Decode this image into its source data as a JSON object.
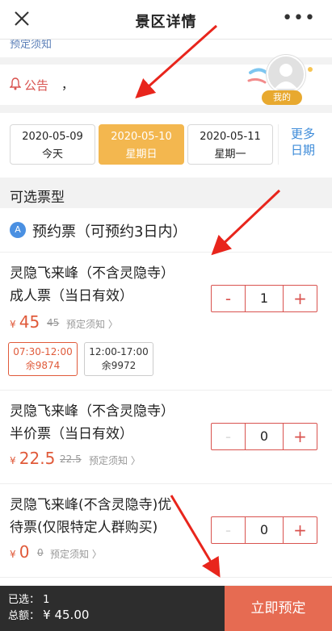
{
  "header": {
    "title": "景区详情",
    "more": "•••"
  },
  "top_strip": {
    "text": "预定须知"
  },
  "notice": {
    "label": "公告",
    "text": "，"
  },
  "avatar": {
    "badge": "我的"
  },
  "dates": [
    {
      "date": "2020-05-09",
      "weekday": "今天",
      "selected": false
    },
    {
      "date": "2020-05-10",
      "weekday": "星期日",
      "selected": true
    },
    {
      "date": "2020-05-11",
      "weekday": "星期一",
      "selected": false
    }
  ],
  "more_dates": {
    "line1": "更多",
    "line2": "日期"
  },
  "section_title": "可选票型",
  "group": {
    "icon": "A",
    "title": "预约票（可预约3日内）"
  },
  "tickets": [
    {
      "name_line1": "灵隐飞来峰（不含灵隐寺）",
      "name_line2": "成人票（当日有效）",
      "currency": "¥",
      "price": "45",
      "original": "45",
      "notice_link": "预定须知",
      "quantity": "1",
      "slots": [
        {
          "time": "07:30-12:00",
          "remain": "余9874",
          "selected": true
        },
        {
          "time": "12:00-17:00",
          "remain": "余9972",
          "selected": false
        }
      ]
    },
    {
      "name_line1": "灵隐飞来峰（不含灵隐寺）",
      "name_line2": "半价票（当日有效）",
      "currency": "¥",
      "price": "22.5",
      "original": "22.5",
      "notice_link": "预定须知",
      "quantity": "0"
    },
    {
      "name_line1": "灵隐飞来峰(不含灵隐寺)优",
      "name_line2": "待票(仅限特定人群购买)",
      "currency": "¥",
      "price": "0",
      "original": "0",
      "notice_link": "预定须知",
      "quantity": "0"
    }
  ],
  "stepper": {
    "minus": "-",
    "plus": "+"
  },
  "bottom_bar": {
    "selected_label": "已选：",
    "selected_count": "1",
    "total_label": "总额：",
    "total_value": "¥ 45.00",
    "buy_label": "立即预定"
  },
  "colors": {
    "accent": "#e05a3a",
    "selected_date": "#f3b74f",
    "link_blue": "#3d8bd9",
    "buy_button": "#e66b52",
    "bottom_bar": "#2d2d2d"
  }
}
